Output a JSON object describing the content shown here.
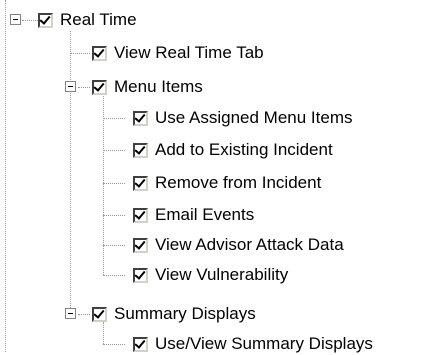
{
  "tree": {
    "real_time": {
      "label": "Real Time",
      "children": {
        "view_real_time_tab": "View Real Time Tab",
        "menu_items": {
          "label": "Menu Items",
          "children": {
            "use_assigned_menu_items": "Use Assigned Menu Items",
            "add_to_existing_incident": "Add to Existing Incident",
            "remove_from_incident": "Remove from Incident",
            "email_events": "Email Events",
            "view_advisor_attack_data": "View Advisor Attack Data",
            "view_vulnerability": "View Vulnerability"
          }
        },
        "summary_displays": {
          "label": "Summary Displays",
          "children": {
            "use_view_summary_displays": "Use/View Summary Displays"
          }
        }
      }
    }
  },
  "checked": true,
  "icons": {
    "expander": "collapse-minus-icon",
    "checkbox": "checkbox-checked-icon"
  },
  "colors": {
    "background": "#ffffff",
    "guide_lines": "#9a9a9a",
    "text": "#000000"
  }
}
